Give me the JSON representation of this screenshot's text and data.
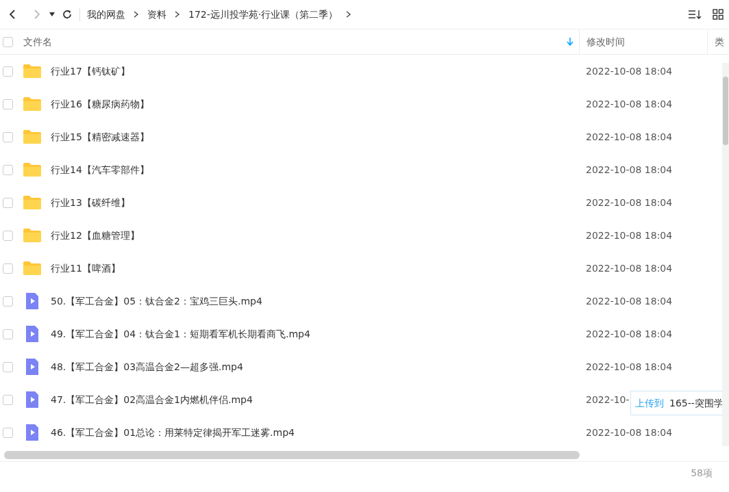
{
  "toolbar": {
    "back": {
      "disabled": false
    },
    "forward": {
      "disabled": true
    },
    "breadcrumb": [
      "我的网盘",
      "资料",
      "172-远川投学苑·行业课（第二季）"
    ]
  },
  "columns": [
    {
      "label": "文件名",
      "sorted": true
    },
    {
      "label": "修改时间",
      "sorted": false
    },
    {
      "label": "类",
      "sorted": false
    }
  ],
  "header_checked": false,
  "rows": [
    {
      "kind": "folder",
      "name": "行业17【钙钛矿】",
      "modified": "2022-10-08 18:04",
      "checked": false
    },
    {
      "kind": "folder",
      "name": "行业16【糖尿病药物】",
      "modified": "2022-10-08 18:04",
      "checked": false
    },
    {
      "kind": "folder",
      "name": "行业15【精密减速器】",
      "modified": "2022-10-08 18:04",
      "checked": false
    },
    {
      "kind": "folder",
      "name": "行业14【汽车零部件】",
      "modified": "2022-10-08 18:04",
      "checked": false
    },
    {
      "kind": "folder",
      "name": "行业13【碳纤维】",
      "modified": "2022-10-08 18:04",
      "checked": false
    },
    {
      "kind": "folder",
      "name": "行业12【血糖管理】",
      "modified": "2022-10-08 18:04",
      "checked": false
    },
    {
      "kind": "folder",
      "name": "行业11【啤酒】",
      "modified": "2022-10-08 18:04",
      "checked": false
    },
    {
      "kind": "video",
      "name": "50.【军工合金】05：钛合金2：宝鸡三巨头.mp4",
      "modified": "2022-10-08 18:04",
      "checked": false
    },
    {
      "kind": "video",
      "name": "49.【军工合金】04：钛合金1：短期看军机长期看商飞.mp4",
      "modified": "2022-10-08 18:04",
      "checked": false
    },
    {
      "kind": "video",
      "name": "48.【军工合金】03高温合金2—超多强.mp4",
      "modified": "2022-10-08 18:04",
      "checked": false
    },
    {
      "kind": "video",
      "name": "47.【军工合金】02高温合金1内燃机伴侣.mp4",
      "modified": "2022-10-",
      "checked": false,
      "tooltip": {
        "action": "上传到",
        "target": "165--突围学"
      }
    },
    {
      "kind": "video",
      "name": "46.【军工合金】01总论：用莱特定律揭开军工迷雾.mp4",
      "modified": "2022-10-08 18:04",
      "checked": false
    }
  ],
  "footer": {
    "count": "58项"
  }
}
